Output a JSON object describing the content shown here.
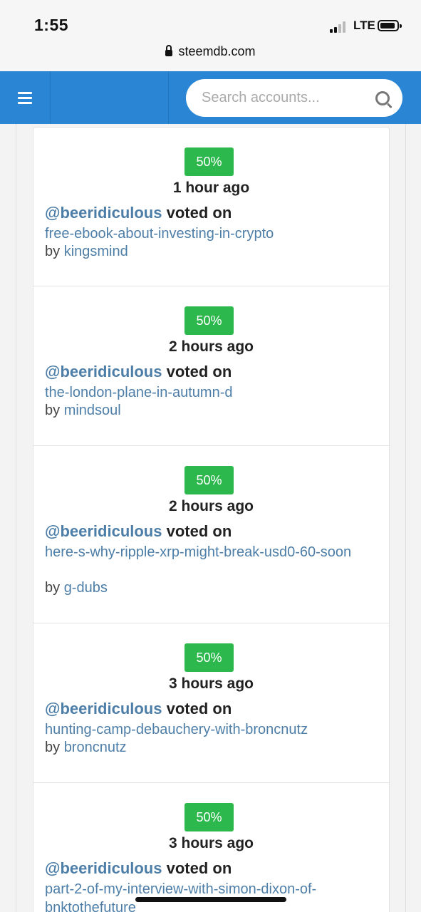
{
  "status_bar": {
    "time": "1:55",
    "network": "LTE",
    "url": "steemdb.com"
  },
  "header": {
    "menu_icon": "hamburger-icon",
    "search_placeholder": "Search accounts...",
    "search_icon": "search-icon"
  },
  "votes": [
    {
      "weight": "50%",
      "ago": "1 hour ago",
      "voter": "@beeridiculous",
      "action": " voted on",
      "permlink": "free-ebook-about-investing-in-crypto",
      "by_label": "by ",
      "author": "kingsmind"
    },
    {
      "weight": "50%",
      "ago": "2 hours ago",
      "voter": "@beeridiculous",
      "action": " voted on",
      "permlink": "the-london-plane-in-autumn-d",
      "by_label": "by ",
      "author": "mindsoul"
    },
    {
      "weight": "50%",
      "ago": "2 hours ago",
      "voter": "@beeridiculous",
      "action": " voted on",
      "permlink": "here-s-why-ripple-xrp-might-break-usd0-60-soon",
      "by_label": "by ",
      "author": "g-dubs"
    },
    {
      "weight": "50%",
      "ago": "3 hours ago",
      "voter": "@beeridiculous",
      "action": " voted on",
      "permlink": "hunting-camp-debauchery-with-broncnutz",
      "by_label": "by ",
      "author": "broncnutz"
    },
    {
      "weight": "50%",
      "ago": "3 hours ago",
      "voter": "@beeridiculous",
      "action": " voted on",
      "permlink": "part-2-of-my-interview-with-simon-dixon-of-bnktothefuture",
      "by_label": "",
      "author": ""
    }
  ],
  "colors": {
    "header_blue": "#2a86d4",
    "badge_green": "#2db84d",
    "link_blue": "#4d7ea8"
  }
}
